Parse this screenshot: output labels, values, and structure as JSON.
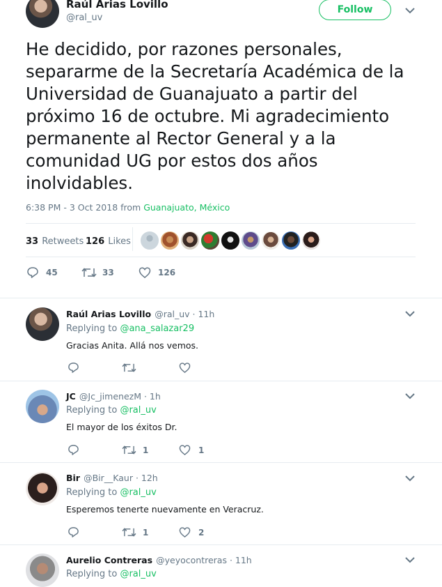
{
  "main_tweet": {
    "author_name": "Raúl Arias Lovillo",
    "author_handle": "@ral_uv",
    "follow_label": "Follow",
    "text": "He decidido, por razones personales, separarme de la Secretaría Académica de la Universidad de Guanajuato a partir del próximo 16 de octubre. Mi agradecimiento permanente al Rector General y a la comunidad UG por estos dos años inolvidables.",
    "timestamp": "6:38 PM - 3 Oct 2018 from ",
    "location": "Guanajuato, México",
    "retweets_count": "33",
    "retweets_label": "Retweets",
    "likes_count": "126",
    "likes_label": "Likes",
    "actions": {
      "replies": "45",
      "retweets": "33",
      "likes": "126"
    }
  },
  "replies": [
    {
      "name": "Raúl Arias Lovillo",
      "handle_time": "@ral_uv · 11h",
      "replying_label": "Replying to ",
      "replying_to": "@ana_salazar29",
      "text": "Gracias Anita. Allá nos vemos.",
      "retweets": "",
      "likes": ""
    },
    {
      "name": "JC",
      "handle_time": "@Jc_jimenezM · 1h",
      "replying_label": "Replying to ",
      "replying_to": "@ral_uv",
      "text": "El mayor de los éxitos Dr.",
      "retweets": "1",
      "likes": "1"
    },
    {
      "name": "Bir",
      "handle_time": "@Bir__Kaur · 12h",
      "replying_label": "Replying to ",
      "replying_to": "@ral_uv",
      "text": "Esperemos tenerte nuevamente en Veracruz.",
      "retweets": "1",
      "likes": "2"
    },
    {
      "name": "Aurelio Contreras",
      "handle_time": "@yeyocontreras · 11h",
      "replying_label": "Replying to ",
      "replying_to": "@ral_uv"
    }
  ],
  "icons": {
    "reply": "reply-icon",
    "retweet": "retweet-icon",
    "like": "heart-icon",
    "menu": "chevron-down-icon"
  },
  "colors": {
    "accent": "#17bf63",
    "secondary_text": "#657786",
    "primary_text": "#14171a",
    "divider": "#e6ecf0"
  }
}
